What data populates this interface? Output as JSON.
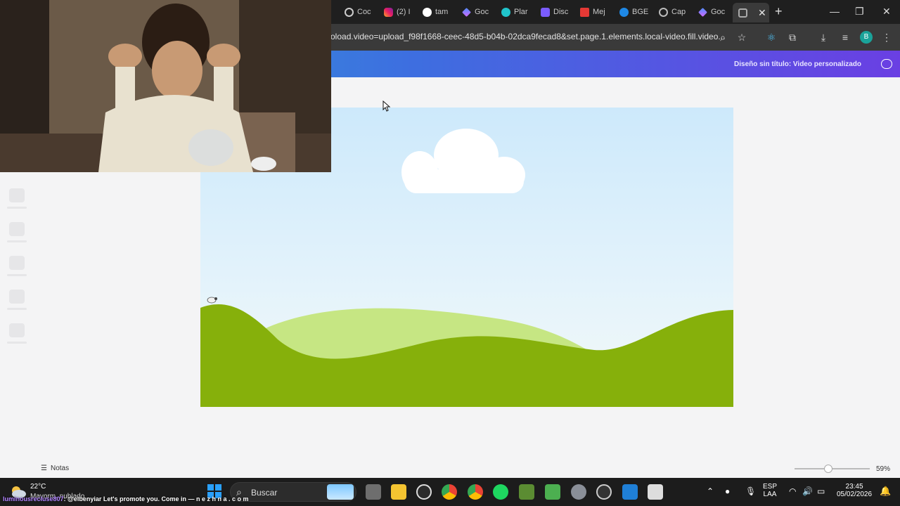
{
  "browser": {
    "tabs": [
      {
        "label": "Coc",
        "icon": "openai-icon"
      },
      {
        "label": "(2) I",
        "icon": "instagram-icon"
      },
      {
        "label": "tam",
        "icon": "google-icon"
      },
      {
        "label": "Goc",
        "icon": "gemini-icon"
      },
      {
        "label": "Plar",
        "icon": "canva-icon"
      },
      {
        "label": "Disc",
        "icon": "shield-icon"
      },
      {
        "label": "Mej",
        "icon": "adobe-icon"
      },
      {
        "label": "BGE",
        "icon": "bge-icon"
      },
      {
        "label": "Cap",
        "icon": "globe-icon"
      },
      {
        "label": "Goc",
        "icon": "gemini-icon"
      }
    ],
    "url": "oload.video=upload_f98f1668-ceec-48d5-b04b-02dca9fecad8&set.page.1.elements.local-video.fill.video...",
    "profile_initial": "B"
  },
  "canva": {
    "design_title": "Diseño sin título: Video personalizado",
    "notes_label": "Notas",
    "zoom": "59%",
    "zoom_fraction": 0.45
  },
  "taskbar": {
    "weather_temp": "22°C",
    "weather_status": "Mayorm. nublado",
    "search_label": "Buscar",
    "lang_top": "ESP",
    "lang_bottom": "LAA",
    "time": "23:45",
    "date": "05/02/2026"
  },
  "ticker": {
    "user": "luminousrecluse807",
    "message": ": @elbenyiar Let's promote you. Come in — n e z h n a . c o m"
  },
  "colors": {
    "header_start": "#2fa7d4",
    "header_end": "#6a3fe3",
    "hill_dark": "#86b00b",
    "hill_light": "#c6e683"
  }
}
